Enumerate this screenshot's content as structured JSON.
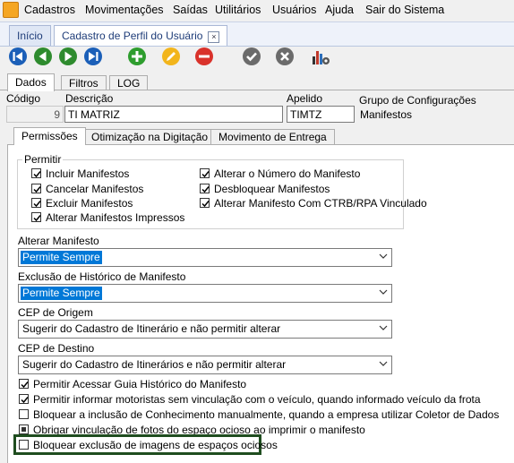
{
  "menu": [
    "Cadastros",
    "Movimentações",
    "Saídas",
    "Utilitários",
    "Usuários",
    "Ajuda",
    "Sair do Sistema"
  ],
  "doc_tabs": {
    "home": "Início",
    "profile": "Cadastro de Perfil do Usuário",
    "close": "⊠"
  },
  "section_tabs": [
    "Dados",
    "Filtros",
    "LOG"
  ],
  "fields": {
    "codigo_label": "Código",
    "codigo_value": "9",
    "descricao_label": "Descrição",
    "descricao_value": "TI MATRIZ",
    "apelido_label": "Apelido",
    "apelido_value": "TIMTZ",
    "grupo_label": "Grupo de Configurações",
    "grupo_value": "Manifestos"
  },
  "inner_tabs": [
    "Permissões",
    "Otimização na Digitação",
    "Movimento de Entrega"
  ],
  "permitir": {
    "title": "Permitir",
    "left": [
      "Incluir Manifestos",
      "Cancelar Manifestos",
      "Excluir Manifestos",
      "Alterar Manifestos Impressos"
    ],
    "right": [
      "Alterar o Número do Manifesto",
      "Desbloquear Manifestos",
      "Alterar Manifesto Com CTRB/RPA Vinculado"
    ]
  },
  "combos": [
    {
      "label": "Alterar Manifesto",
      "value": "Permite Sempre"
    },
    {
      "label": "Exclusão de Histórico de Manifesto",
      "value": "Permite Sempre"
    },
    {
      "label": "CEP de Origem",
      "value": "Sugerir do Cadastro de Itinerário e não permitir alterar"
    },
    {
      "label": "CEP de Destino",
      "value": "Sugerir do Cadastro de Itinerários e não permitir alterar"
    }
  ],
  "options": [
    "Permitir Acessar Guia Histórico do Manifesto",
    "Permitir informar motoristas sem vinculação com  o veículo, quando informado veículo da frota",
    "Bloquear a inclusão de  Conhecimento  manualmente, quando a empresa utilizar Coletor de Dados",
    "Obrigar vinculação de fotos do espaço ocioso ao imprimir o manifesto",
    "Bloquear exclusão de imagens de espaços ociosos"
  ],
  "colors": {
    "highlight_border": "#1f4d1f",
    "selection": "#0078d7"
  }
}
